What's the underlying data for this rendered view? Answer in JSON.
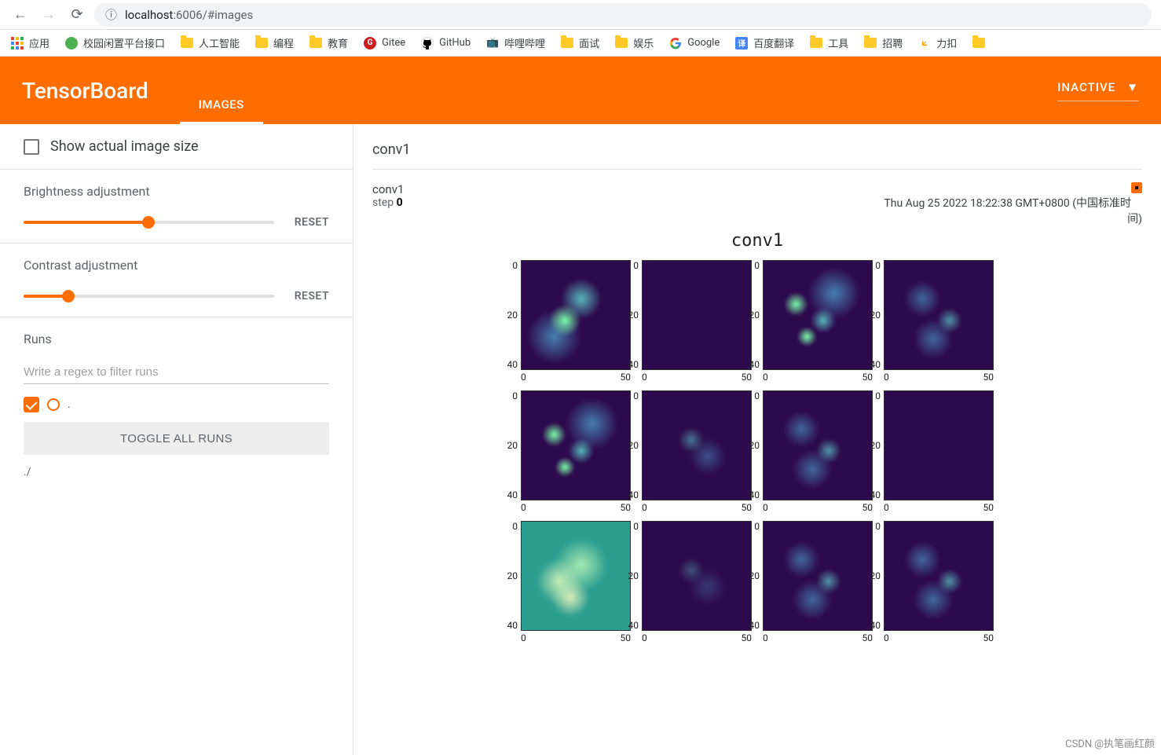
{
  "browser": {
    "url_prefix": "localhost",
    "url_port": ":6006",
    "url_path": "/#images"
  },
  "bookmarks": {
    "apps": "应用",
    "items": [
      {
        "label": "校园闲置平台接口",
        "type": "circ",
        "color": "#4CAF50"
      },
      {
        "label": "人工智能",
        "type": "folder"
      },
      {
        "label": "编程",
        "type": "folder"
      },
      {
        "label": "教育",
        "type": "folder"
      },
      {
        "label": "Gitee",
        "type": "gitee"
      },
      {
        "label": "GitHub",
        "type": "github"
      },
      {
        "label": "哔哩哔哩",
        "type": "bili"
      },
      {
        "label": "面试",
        "type": "folder"
      },
      {
        "label": "娱乐",
        "type": "folder"
      },
      {
        "label": "Google",
        "type": "google"
      },
      {
        "label": "百度翻译",
        "type": "trans"
      },
      {
        "label": "工具",
        "type": "folder"
      },
      {
        "label": "招聘",
        "type": "folder"
      },
      {
        "label": "力扣",
        "type": "leet"
      },
      {
        "label": "",
        "type": "folder"
      }
    ]
  },
  "header": {
    "logo": "TensorBoard",
    "tabs": [
      {
        "label": "IMAGES",
        "active": true
      }
    ],
    "inactive": "INACTIVE"
  },
  "sidebar": {
    "show_actual": "Show actual image size",
    "brightness_label": "Brightness adjustment",
    "contrast_label": "Contrast adjustment",
    "reset": "RESET",
    "brightness_pct": 50,
    "contrast_pct": 18,
    "runs_title": "Runs",
    "runs_placeholder": "Write a regex to filter runs",
    "run_dot_label": ".",
    "toggle_all": "TOGGLE ALL RUNS",
    "run_path": "./"
  },
  "content": {
    "section_title": "conv1",
    "card_tag": "conv1",
    "step_label": "step",
    "step_value": "0",
    "timestamp": "Thu Aug 25 2022 18:22:38 GMT+0800 (中国标准时间)",
    "image_title": "conv1",
    "yticks": [
      "0",
      "20",
      "40"
    ],
    "xticks": [
      "0",
      "50"
    ]
  },
  "watermark": "CSDN @执笔画红颜"
}
